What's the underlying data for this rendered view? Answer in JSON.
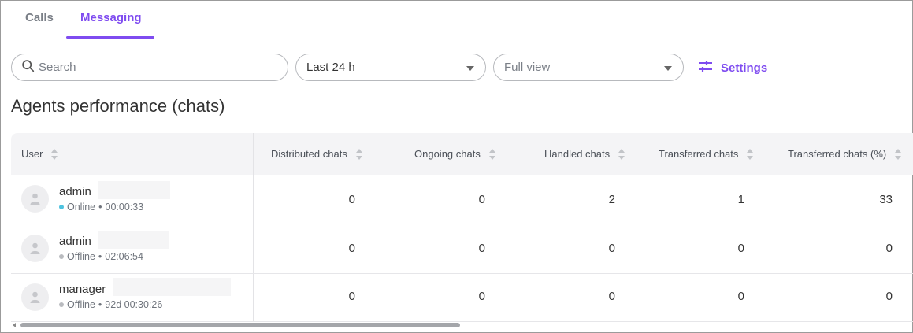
{
  "tabs": [
    {
      "label": "Calls",
      "active": false
    },
    {
      "label": "Messaging",
      "active": true
    }
  ],
  "toolbar": {
    "search_placeholder": "Search",
    "period_value": "Last 24 h",
    "view_value": "Full view",
    "settings_label": "Settings"
  },
  "page_title": "Agents performance (chats)",
  "table": {
    "columns": [
      "User",
      "Distributed chats",
      "Ongoing chats",
      "Handled chats",
      "Transferred chats",
      "Transferred chats (%)"
    ],
    "rows": [
      {
        "user": "admin",
        "status": "Online",
        "status_color": "#4ec3e0",
        "duration": "00:00:33",
        "values": [
          "0",
          "0",
          "2",
          "1",
          "33"
        ]
      },
      {
        "user": "admin",
        "status": "Offline",
        "status_color": "#b9bbbf",
        "duration": "02:06:54",
        "values": [
          "0",
          "0",
          "0",
          "0",
          "0"
        ]
      },
      {
        "user": "manager",
        "status": "Offline",
        "status_color": "#b9bbbf",
        "duration": "92d 00:30:26",
        "values": [
          "0",
          "0",
          "0",
          "0",
          "0"
        ]
      }
    ]
  },
  "colors": {
    "accent": "#7f4cf0"
  },
  "icons": {
    "search": "search-icon",
    "settings": "sliders-icon",
    "avatar": "user-icon",
    "sort": "sort-icon"
  }
}
